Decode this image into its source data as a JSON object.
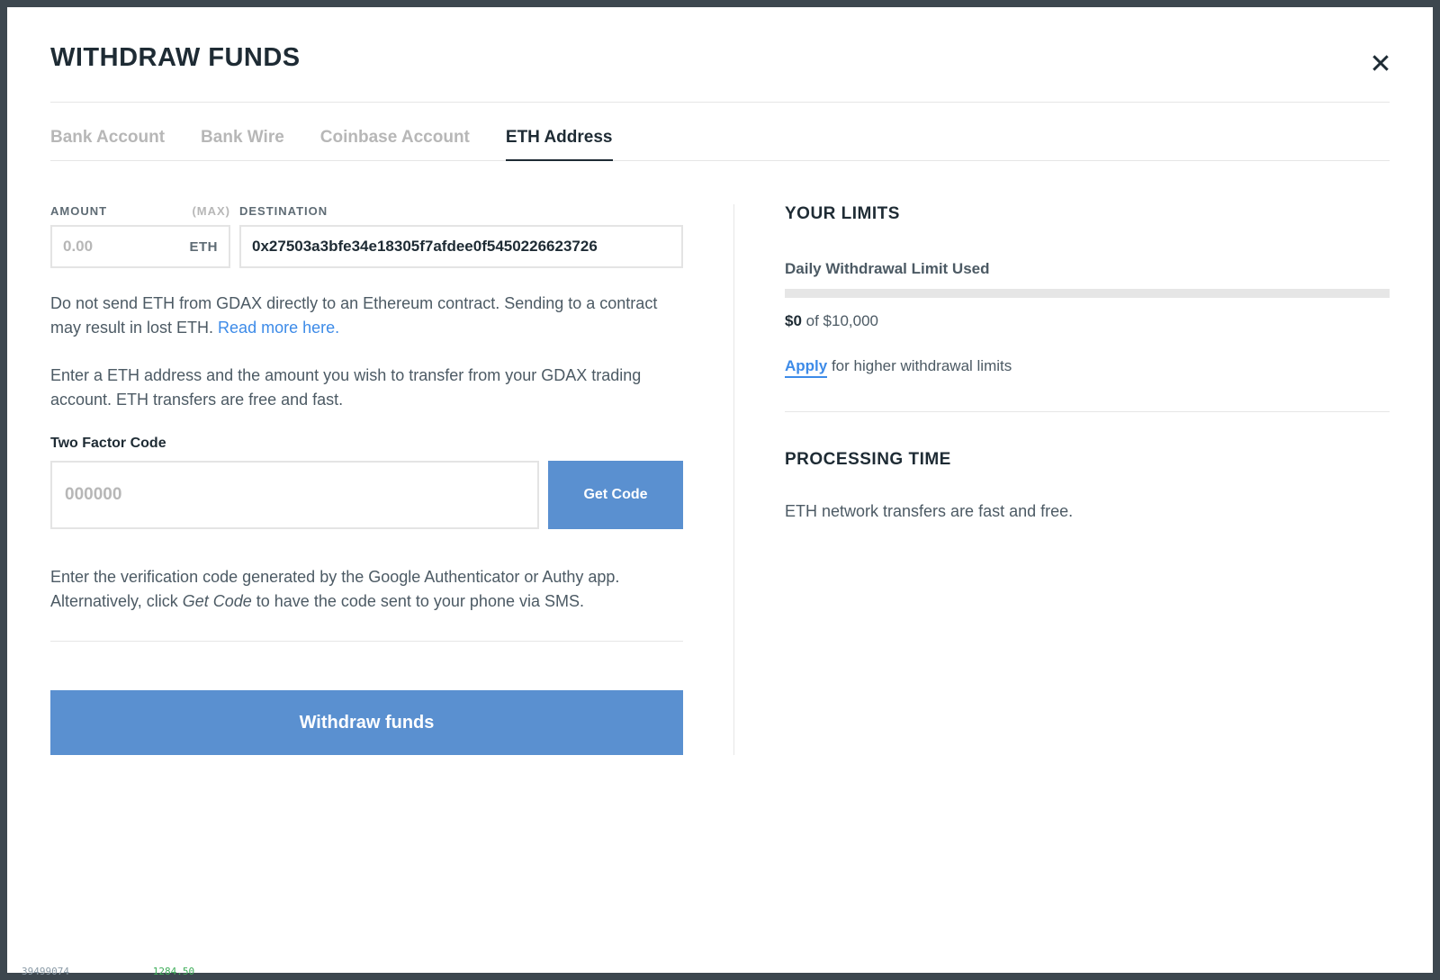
{
  "title": "WITHDRAW FUNDS",
  "tabs": [
    {
      "label": "Bank Account"
    },
    {
      "label": "Bank Wire"
    },
    {
      "label": "Coinbase Account"
    },
    {
      "label": "ETH Address"
    }
  ],
  "active_tab_index": 3,
  "amount": {
    "label": "AMOUNT",
    "max_label": "(MAX)",
    "placeholder": "0.00",
    "unit": "ETH"
  },
  "destination": {
    "label": "DESTINATION",
    "value": "0x27503a3bfe34e18305f7afdee0f5450226623726"
  },
  "warning_text": "Do not send ETH from GDAX directly to an Ethereum contract. Sending to a contract may result in lost ETH. ",
  "warning_link": "Read more here.",
  "instruction_text": "Enter a ETH address and the amount you wish to transfer from your GDAX trading account. ETH transfers are free and fast.",
  "tfa": {
    "label": "Two Factor Code",
    "placeholder": "000000",
    "get_code": "Get Code"
  },
  "tfa_help_pre": "Enter the verification code generated by the Google Authenticator or Authy app. Alternatively, click ",
  "tfa_help_em": "Get Code",
  "tfa_help_post": " to have the code sent to your phone via SMS.",
  "withdraw_button": "Withdraw funds",
  "limits": {
    "title": "YOUR LIMITS",
    "daily_label": "Daily Withdrawal Limit Used",
    "used": "$0",
    "of_total": " of $10,000",
    "apply_link": "Apply",
    "apply_rest": " for higher withdrawal limits"
  },
  "processing": {
    "title": "PROCESSING TIME",
    "text": "ETH network transfers are fast and free."
  },
  "bg_numbers_a": "39499074",
  "bg_numbers_b": "1284.50"
}
